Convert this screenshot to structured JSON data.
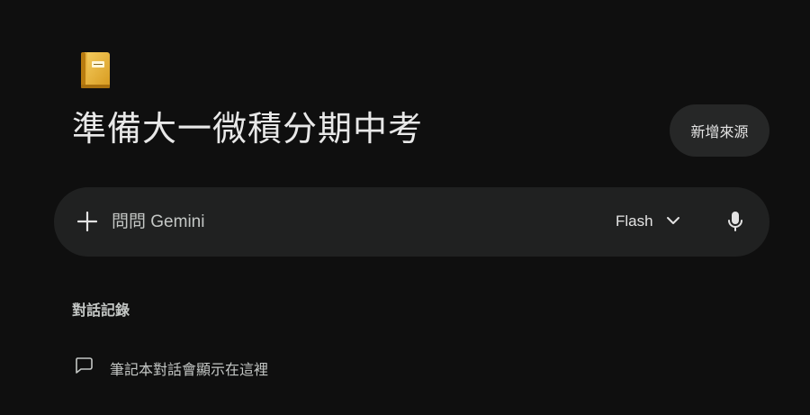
{
  "notebook": {
    "emoji_icon": "notebook-icon",
    "title": "準備大一微積分期中考"
  },
  "header": {
    "add_source_label": "新增來源"
  },
  "prompt": {
    "add_icon": "plus-icon",
    "placeholder": "問問 Gemini",
    "value": "",
    "model_selected": "Flash",
    "dropdown_icon": "chevron-down-icon",
    "mic_icon": "mic-icon"
  },
  "history": {
    "heading": "對話記錄",
    "empty_message": "筆記本對話會顯示在這裡",
    "item_icon": "chat-bubble-icon"
  },
  "colors": {
    "background": "#0f0f0f",
    "surface": "#202121",
    "button": "#262727",
    "text": "#e3e3e3",
    "muted_text": "#c4c7c5",
    "notebook_yellow": "#f0b429"
  }
}
